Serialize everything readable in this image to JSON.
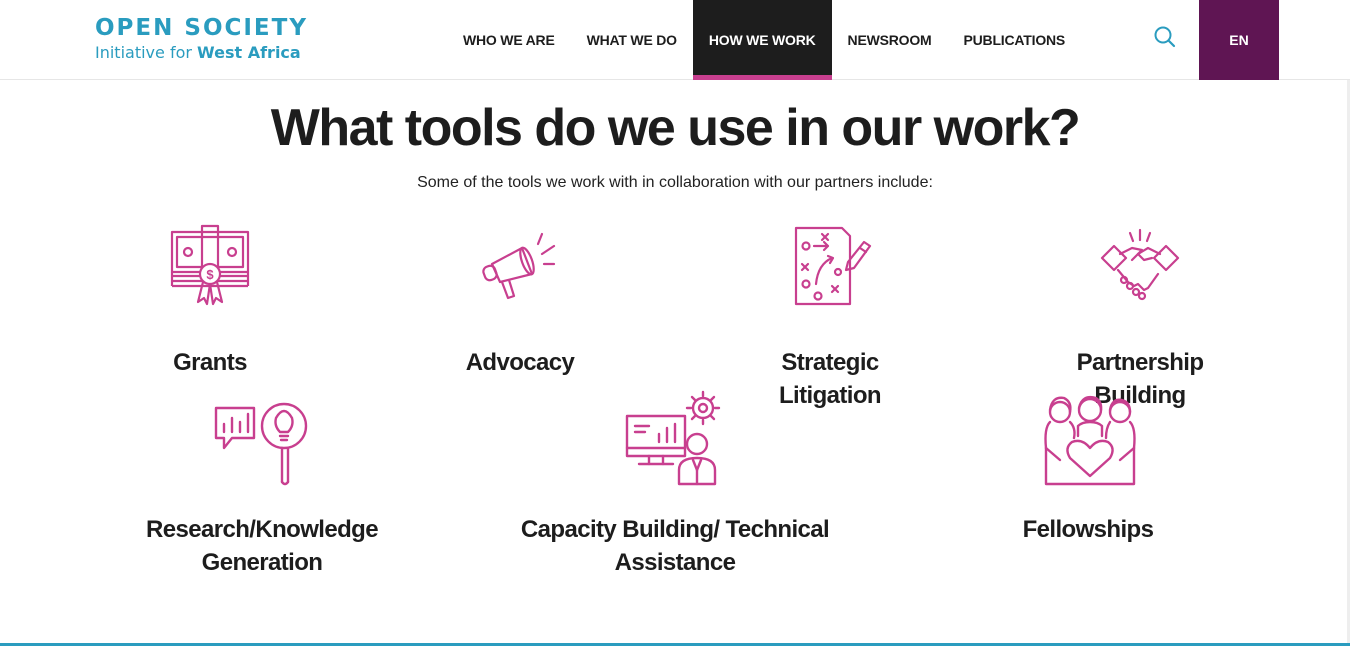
{
  "header": {
    "logo_line1": "OPEN SOCIETY",
    "logo_line2_pre": "Initiative for ",
    "logo_line2_strong": "West Africa",
    "nav": [
      {
        "label": "WHO WE ARE"
      },
      {
        "label": "WHAT WE DO"
      },
      {
        "label": "HOW WE WORK",
        "active": true
      },
      {
        "label": "NEWSROOM"
      },
      {
        "label": "PUBLICATIONS"
      }
    ],
    "search_icon": "search-icon",
    "language": "EN"
  },
  "main": {
    "title": "What tools do we use in our work?",
    "subtitle": "Some of the tools we work with in collaboration with our partners include:",
    "tools": [
      {
        "label": "Grants",
        "icon": "money-bundle-icon"
      },
      {
        "label": "Advocacy",
        "icon": "megaphone-icon"
      },
      {
        "label": "Strategic Litigation",
        "icon": "strategy-plan-icon"
      },
      {
        "label": "Partnership Building",
        "icon": "handshake-icon"
      },
      {
        "label_line1": "Research/Knowledge",
        "label_line2": "Generation",
        "icon": "research-bulb-icon"
      },
      {
        "label_line1": "Capacity Building/ Technical",
        "label_line2": "Assistance",
        "icon": "training-presentation-icon"
      },
      {
        "label": "Fellowships",
        "icon": "people-heart-icon"
      }
    ]
  },
  "colors": {
    "brand_blue": "#2a9cbf",
    "accent_pink": "#c83f8f",
    "language_purple": "#5f1553",
    "nav_active_bg": "#1d1d1d"
  }
}
